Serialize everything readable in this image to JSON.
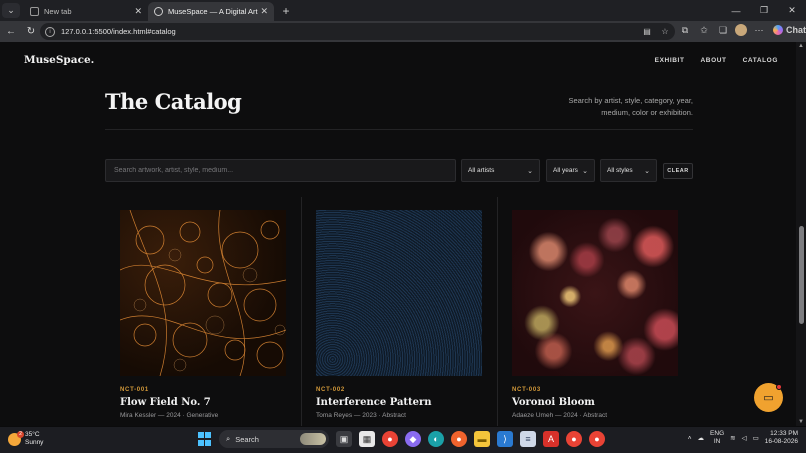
{
  "browser": {
    "tabs": [
      {
        "label": "New tab",
        "active": false
      },
      {
        "label": "MuseSpace — A Digital Art Gallery",
        "active": true
      }
    ],
    "url": "127.0.0.1:5500/index.html#catalog",
    "chat_label": "Chat"
  },
  "site": {
    "brand": "MuseSpace.",
    "nav": [
      "EXHIBIT",
      "ABOUT",
      "CATALOG"
    ]
  },
  "catalog": {
    "title": "The Catalog",
    "subtitle": "Search by artist, style, category, year, medium, color or exhibition.",
    "search_placeholder": "Search artwork, artist, style, medium...",
    "filters": {
      "artists": "All artists",
      "years": "All years",
      "styles": "All styles"
    },
    "clear_label": "CLEAR",
    "items": [
      {
        "code": "NCT-001",
        "title": "Flow Field No. 7",
        "meta": "Mira Kessler — 2024 · Generative"
      },
      {
        "code": "NCT-002",
        "title": "Interference Pattern",
        "meta": "Toma Reyes — 2023 · Abstract"
      },
      {
        "code": "NCT-003",
        "title": "Voronoi Bloom",
        "meta": "Adaeze Umeh — 2024 · Abstract"
      }
    ]
  },
  "colors": {
    "accent": "#d49a3a",
    "fab": "#f0a22f",
    "background": "#0d0d0e"
  },
  "taskbar": {
    "weather_temp": "35°C",
    "weather_desc": "Sunny",
    "weather_badge": "2",
    "search_label": "Search",
    "lang_top": "ENG",
    "lang_bottom": "IN",
    "time": "12:33 PM",
    "date": "16-08-2026"
  }
}
